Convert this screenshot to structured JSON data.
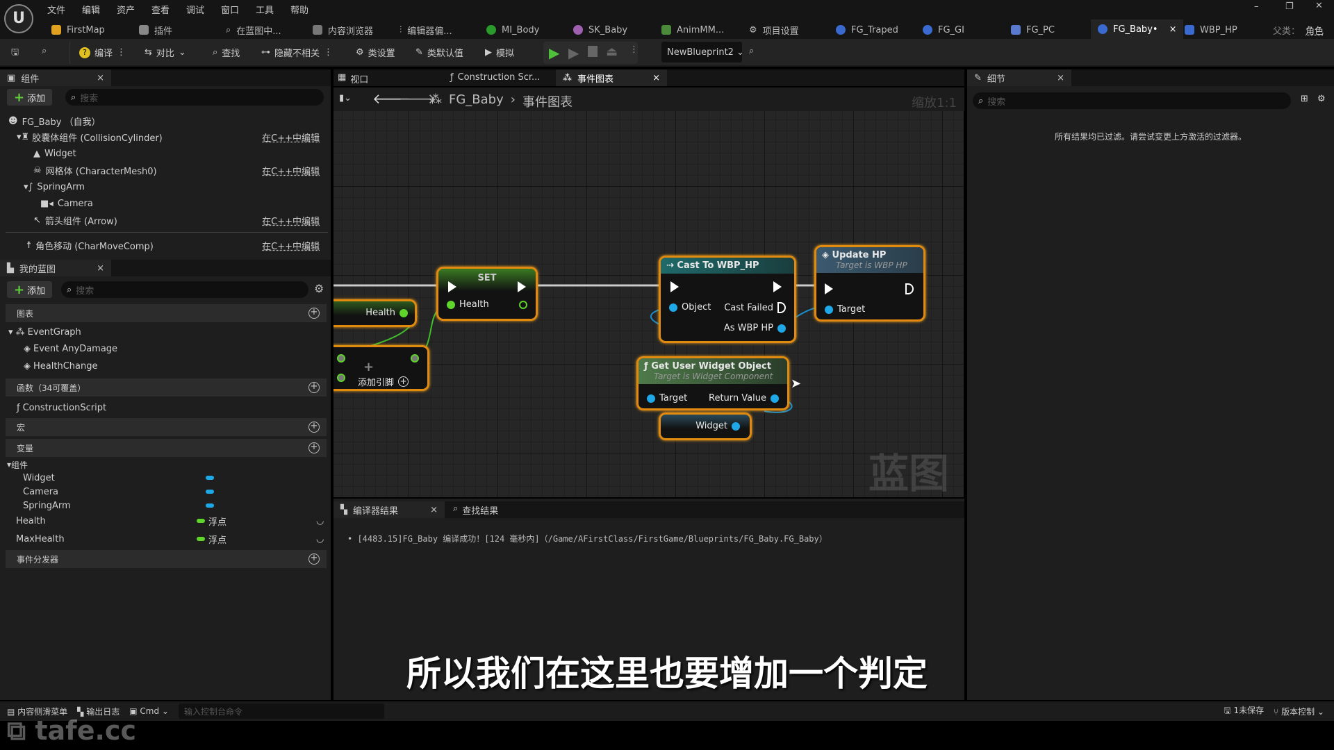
{
  "menu": [
    "文件",
    "编辑",
    "资产",
    "查看",
    "调试",
    "窗口",
    "工具",
    "帮助"
  ],
  "tabs": [
    {
      "label": "FirstMap"
    },
    {
      "label": "插件"
    },
    {
      "label": "在蓝图中..."
    },
    {
      "label": "内容浏览器"
    },
    {
      "label": "编辑器偏..."
    },
    {
      "label": "MI_Body"
    },
    {
      "label": "SK_Baby"
    },
    {
      "label": "AnimMM..."
    },
    {
      "label": "项目设置"
    },
    {
      "label": "FG_Traped"
    },
    {
      "label": "FG_GI"
    },
    {
      "label": "FG_PC"
    },
    {
      "label": "FG_Baby•"
    },
    {
      "label": "WBP_HP"
    }
  ],
  "parent_class": {
    "label": "父类：",
    "value": "角色"
  },
  "toolbar": {
    "compile": "编译",
    "diff": "对比",
    "find": "查找",
    "hide": "隐藏不相关",
    "class_settings": "类设置",
    "class_defaults": "类默认值",
    "simulate": "模拟",
    "debug_object": "NewBlueprint2"
  },
  "components": {
    "title": "组件",
    "add": "添加",
    "search_placeholder": "搜索",
    "items": [
      {
        "label": "FG_Baby （自我）"
      },
      {
        "label": "胶囊体组件 (CollisionCylinder)",
        "edit": "在C++中编辑"
      },
      {
        "label": "Widget"
      },
      {
        "label": "网格体 (CharacterMesh0)",
        "edit": "在C++中编辑"
      },
      {
        "label": "SpringArm"
      },
      {
        "label": "Camera"
      },
      {
        "label": "箭头组件 (Arrow)",
        "edit": "在C++中编辑"
      },
      {
        "label": "角色移动 (CharMoveComp)",
        "edit": "在C++中编辑"
      }
    ]
  },
  "my_blueprint": {
    "title": "我的蓝图",
    "add": "添加",
    "search_placeholder": "搜索",
    "graphs": "图表",
    "event_graph": "EventGraph",
    "events": [
      "Event AnyDamage",
      "HealthChange"
    ],
    "functions": "函数（34可覆盖）",
    "construction": "ConstructionScript",
    "macros": "宏",
    "variables": "变量",
    "components_group": "组件",
    "component_vars": [
      "Widget",
      "Camera",
      "SpringArm"
    ],
    "vars": [
      {
        "name": "Health",
        "type": "浮点"
      },
      {
        "name": "MaxHealth",
        "type": "浮点"
      }
    ],
    "dispatchers": "事件分发器",
    "colors": {
      "object": "#1fa8e8",
      "float": "#5fd42a"
    }
  },
  "graph_tabs": [
    {
      "label": "视口"
    },
    {
      "label": "Construction Scr..."
    },
    {
      "label": "事件图表"
    }
  ],
  "breadcrumb": {
    "root": "FG_Baby",
    "current": "事件图表"
  },
  "zoom": "缩放1:1",
  "watermark": "蓝图",
  "nodes": {
    "health_get": {
      "pin": "Health"
    },
    "set": {
      "title": "SET",
      "pin": "Health"
    },
    "add": {
      "label": "添加引脚"
    },
    "cast": {
      "title": "Cast To WBP_HP",
      "object": "Object",
      "failed": "Cast Failed",
      "as": "As WBP HP"
    },
    "update": {
      "title": "Update HP",
      "subtitle": "Target is WBP HP",
      "target": "Target"
    },
    "get_widget": {
      "title": "Get User Widget Object",
      "subtitle": "Target is Widget Component",
      "target": "Target",
      "ret": "Return Value"
    },
    "widget_get": {
      "pin": "Widget"
    }
  },
  "details": {
    "title": "细节",
    "search_placeholder": "搜索",
    "empty": "所有结果均已过滤。请尝试变更上方激活的过滤器。"
  },
  "compiler": {
    "tabs": [
      "编译器结果",
      "查找结果"
    ],
    "log": "[4483.15]FG_Baby 编译成功！[124 毫秒内]（/Game/AFirstClass/FirstGame/Blueprints/FG_Baby.FG_Baby）"
  },
  "subtitle": "所以我们在这里也要增加一个判定",
  "statusbar": {
    "drawer": "内容侧滑菜单",
    "output": "输出日志",
    "cmd": "Cmd",
    "cmd_placeholder": "输入控制台命令",
    "unsaved": "1未保存",
    "source_control": "版本控制"
  },
  "watermark_logo": "tafe.cc"
}
